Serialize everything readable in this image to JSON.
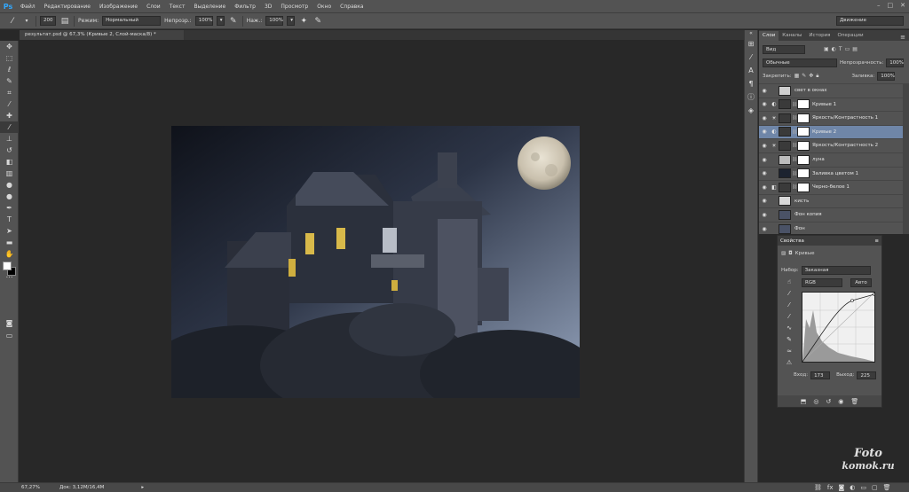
{
  "app": {
    "logo": "Ps"
  },
  "menu": [
    "Файл",
    "Редактирование",
    "Изображение",
    "Слои",
    "Текст",
    "Выделение",
    "Фильтр",
    "3D",
    "Просмотр",
    "Окно",
    "Справка"
  ],
  "options": {
    "brush_size": "200",
    "mode_label": "Режим:",
    "mode_value": "Нормальный",
    "opacity_label": "Непрозр.:",
    "opacity_value": "100%",
    "flow_label": "Наж.:",
    "flow_value": "100%",
    "workspace": "Движение"
  },
  "document": {
    "tab_title": "результат.psd @ 67,3% (Кривые 2, Слой-маска/8) *"
  },
  "status": {
    "zoom": "67,27%",
    "doc_size": "Док: 3,12M/16,4M"
  },
  "layers_panel": {
    "tabs": [
      "Слои",
      "Каналы",
      "История",
      "Операции"
    ],
    "filter_kind": "Вид",
    "blend_mode": "Обычные",
    "opacity_label": "Непрозрачность:",
    "opacity_value": "100%",
    "lock_label": "Закрепить:",
    "fill_label": "Заливка:",
    "fill_value": "100%",
    "layers": [
      {
        "name": "свет в окнах",
        "thumb": "#cfcfcf",
        "mask": false,
        "adj": "",
        "selected": false
      },
      {
        "name": "Кривые 1",
        "thumb": "#3a3a3a",
        "mask": true,
        "adj": "◐",
        "selected": false
      },
      {
        "name": "Яркость/Контрастность 1",
        "thumb": "#3a3a3a",
        "mask": true,
        "adj": "☀",
        "selected": false
      },
      {
        "name": "Кривые 2",
        "thumb": "#3a3a3a",
        "mask": true,
        "adj": "◐",
        "selected": true
      },
      {
        "name": "Яркость/Контрастность 2",
        "thumb": "#3a3a3a",
        "mask": true,
        "adj": "☀",
        "selected": false
      },
      {
        "name": "луна",
        "thumb": "#bdbdbd",
        "mask": true,
        "adj": "",
        "selected": false
      },
      {
        "name": "Заливка цветом 1",
        "thumb": "#1c2330",
        "mask": true,
        "adj": "",
        "selected": false
      },
      {
        "name": "Черно-белое 1",
        "thumb": "#3a3a3a",
        "mask": true,
        "adj": "◧",
        "selected": false
      },
      {
        "name": "кисть",
        "thumb": "#d8d8d8",
        "mask": false,
        "adj": "",
        "selected": false
      },
      {
        "name": "Фон копия",
        "thumb": "#4a5266",
        "mask": false,
        "adj": "",
        "selected": false
      },
      {
        "name": "Фон",
        "thumb": "#4a5266",
        "mask": false,
        "adj": "",
        "selected": false
      }
    ]
  },
  "properties": {
    "tab": "Свойства",
    "title": "Кривые",
    "preset_label": "Набор:",
    "preset_value": "Заказная",
    "channel": "RGB",
    "auto_label": "Авто",
    "input_label": "Вход:",
    "input_value": "173",
    "output_label": "Выход:",
    "output_value": "225"
  },
  "watermark": {
    "line1": "Foto",
    "line2": "komok.ru"
  }
}
